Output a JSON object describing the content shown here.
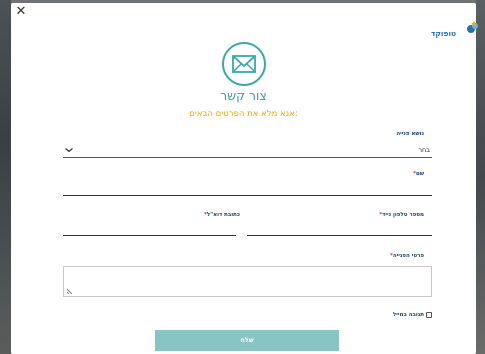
{
  "brand": {
    "name": "טופוקד"
  },
  "header": {
    "title": "צור קשר",
    "subtitle": "אנא מלא את הפרטים הבאים:"
  },
  "form": {
    "subject": {
      "label": "נושא פנייה",
      "value": "בחר"
    },
    "name": {
      "label": "שם",
      "required_mark": "*"
    },
    "phone": {
      "label": "מספר טלפון נייד",
      "required_mark": "*"
    },
    "email": {
      "label": "כתובת דוא\"ל",
      "required_mark": "*"
    },
    "details": {
      "label": "פרטי הפנייה",
      "required_mark": "*"
    },
    "email_reply": {
      "label": "תגובה במייל",
      "checked": false
    },
    "submit_label": "שלח"
  },
  "colors": {
    "accent": "#3aa8a8",
    "subtitle": "#f0a500",
    "label": "#16407a",
    "button": "#87c4c3"
  }
}
